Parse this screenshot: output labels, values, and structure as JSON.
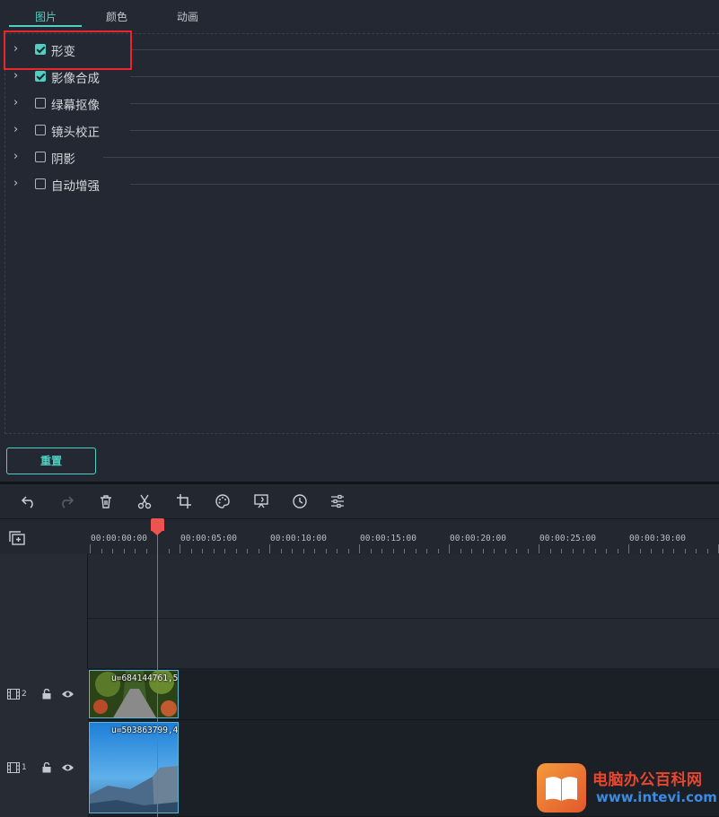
{
  "tabs": [
    {
      "label": "图片",
      "active": true
    },
    {
      "label": "颜色",
      "active": false
    },
    {
      "label": "动画",
      "active": false
    }
  ],
  "properties": [
    {
      "label": "形变",
      "checked": true
    },
    {
      "label": "影像合成",
      "checked": true
    },
    {
      "label": "绿幕抠像",
      "checked": false
    },
    {
      "label": "镜头校正",
      "checked": false
    },
    {
      "label": "阴影",
      "checked": false
    },
    {
      "label": "自动增强",
      "checked": false
    }
  ],
  "reset_label": "重置",
  "toolbar": {
    "icons": [
      "undo-icon",
      "redo-icon",
      "delete-icon",
      "cut-icon",
      "crop-icon",
      "color-icon",
      "green-screen-icon",
      "speed-icon",
      "adjust-icon"
    ]
  },
  "ruler": {
    "timecodes": [
      "00:00:00:00",
      "00:00:05:00",
      "00:00:10:00",
      "00:00:15:00",
      "00:00:20:00",
      "00:00:25:00",
      "00:00:30:00"
    ]
  },
  "tracks": [
    {
      "number": "2",
      "clip_label": "u=684144761,5"
    },
    {
      "number": "1",
      "clip_label": "u=503863799,4"
    }
  ],
  "watermark": {
    "title": "电脑办公百科网",
    "url": "www.intevi.com"
  },
  "colors": {
    "accent": "#4fd0c3",
    "highlight": "#e8262b",
    "playhead": "#ef5350"
  }
}
